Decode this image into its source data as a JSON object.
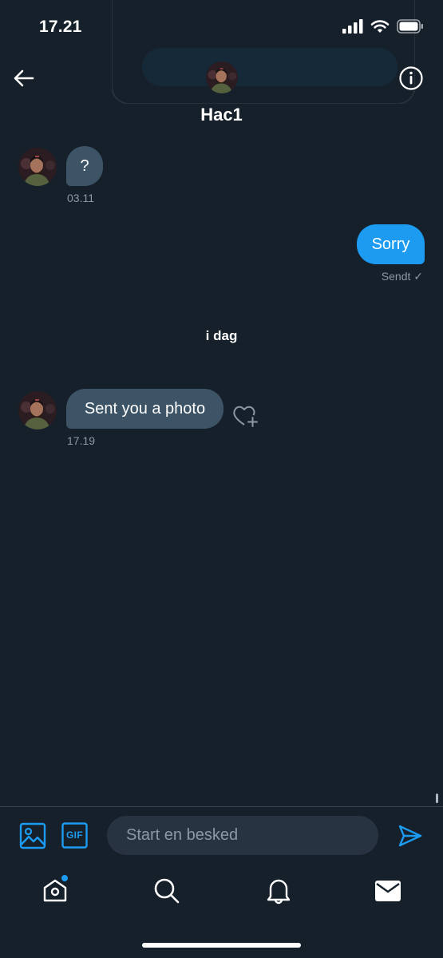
{
  "status_bar": {
    "time": "17.21"
  },
  "header": {
    "name": "Hac1"
  },
  "messages": {
    "m1": {
      "text": "?",
      "time": "03.11"
    },
    "m2": {
      "text": "Sorry",
      "status": "Sendt ✓"
    },
    "day_separator": "i dag",
    "m3": {
      "text": "Sent you a photo",
      "time": "17.19"
    }
  },
  "composer": {
    "placeholder": "Start en besked",
    "gif_label": "GIF"
  },
  "colors": {
    "background": "#15202b",
    "accent": "#1d9bf0",
    "incoming_bubble": "#3d5466"
  },
  "icons": {
    "status": [
      "signal-icon",
      "wifi-icon",
      "battery-icon"
    ],
    "header": [
      "back-arrow-icon",
      "info-icon"
    ],
    "composer": [
      "image-icon",
      "gif-icon",
      "send-icon"
    ],
    "tabbar": [
      "home-icon",
      "search-icon",
      "bell-icon",
      "mail-icon"
    ]
  }
}
